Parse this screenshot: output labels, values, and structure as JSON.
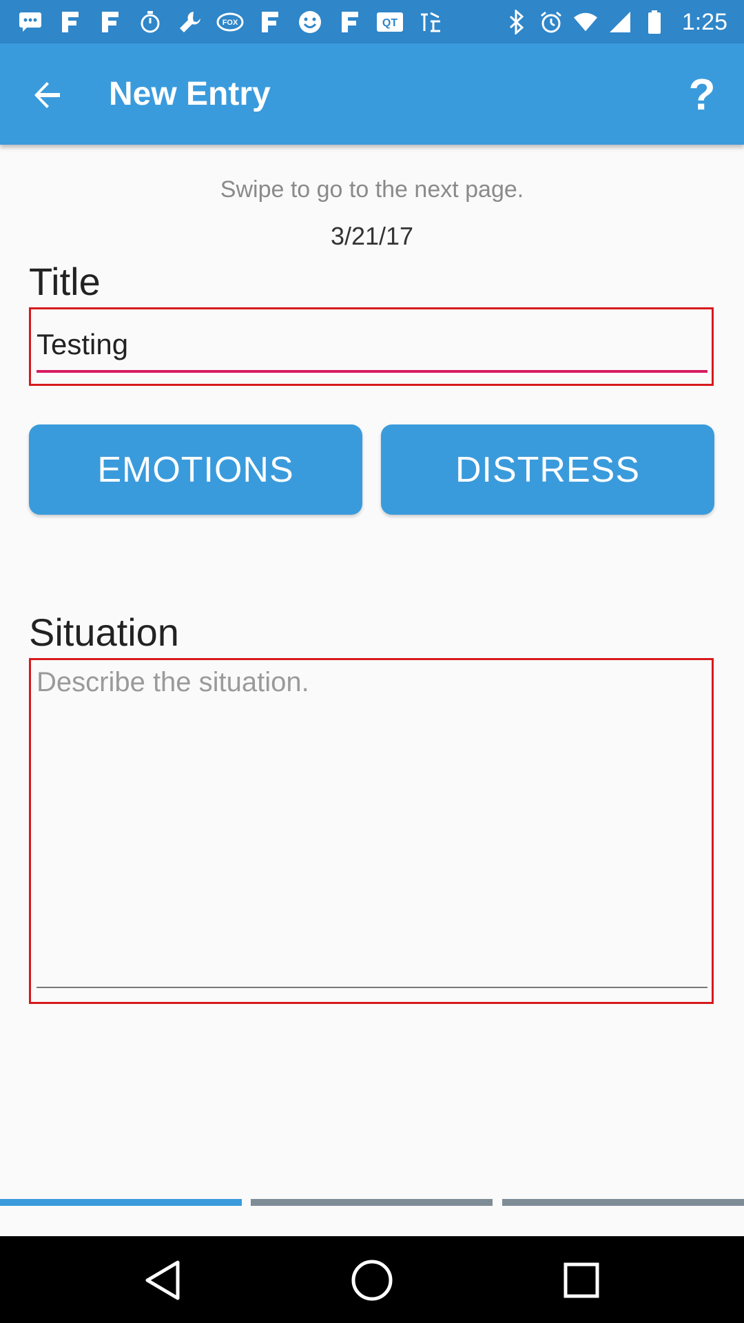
{
  "status_bar": {
    "time": "1:25",
    "left_icons": [
      "message-icon",
      "fox-news-icon",
      "fox-news-icon",
      "stopwatch-icon",
      "wrench-icon",
      "fox-sports-icon",
      "fox-news-icon",
      "smiley-icon",
      "fox-news-icon",
      "qt-icon",
      "app-icon"
    ],
    "right_icons": [
      "bluetooth-icon",
      "alarm-icon",
      "wifi-icon",
      "signal-icon",
      "battery-icon"
    ]
  },
  "app_bar": {
    "title": "New Entry",
    "help_label": "?"
  },
  "content": {
    "hint": "Swipe to go to the next page.",
    "date": "3/21/17",
    "title_label": "Title",
    "title_value": "Testing",
    "emotions_button": "EMOTIONS",
    "distress_button": "DISTRESS",
    "situation_label": "Situation",
    "situation_placeholder": "Describe the situation."
  },
  "page_indicator": {
    "total_pages": 3,
    "current_page": 1
  },
  "colors": {
    "status_bar": "#2f86c9",
    "app_bar": "#3a9bdc",
    "accent": "#d81b60",
    "highlight_border": "#d7191c",
    "indicator_inactive": "#7e8c96"
  }
}
